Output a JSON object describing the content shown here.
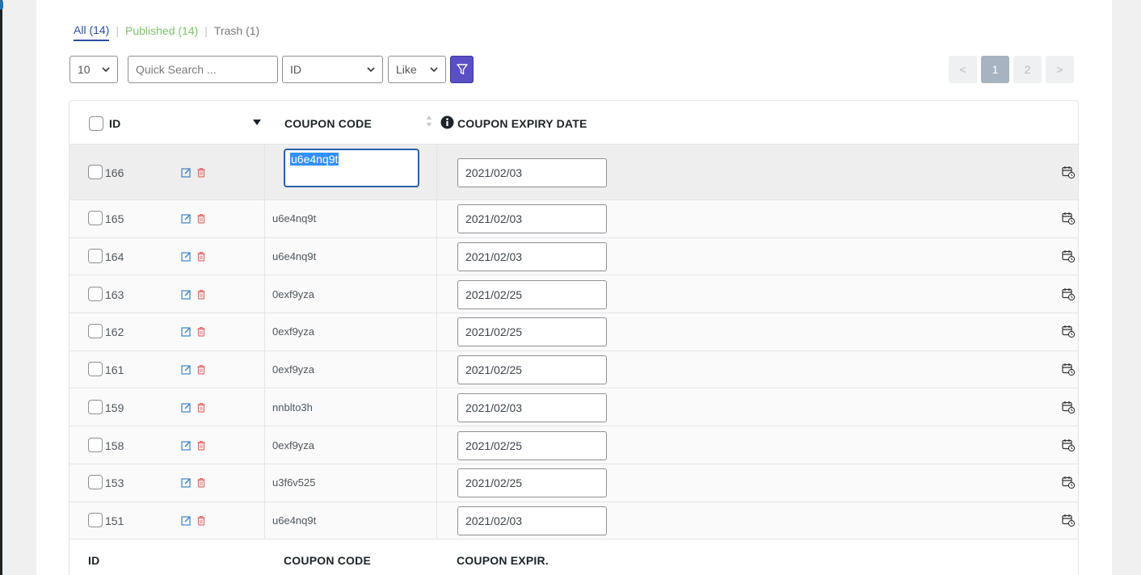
{
  "status_tabs": [
    {
      "label": "All (14)"
    },
    {
      "label": "Published (14)"
    },
    {
      "label": "Trash (1)"
    }
  ],
  "separator": "|",
  "toolbar": {
    "per_page": "10",
    "search_placeholder": "Quick Search ...",
    "field_select": "ID",
    "operator_select": "Like"
  },
  "pagination": {
    "prev": "<",
    "pages": [
      "1",
      "2"
    ],
    "current_page": "1",
    "next": ">"
  },
  "columns": {
    "id": "ID",
    "coupon_code": "COUPON CODE",
    "coupon_expiry_date": "COUPON EXPIRY DATE"
  },
  "footer_columns": {
    "id": "ID",
    "coupon_code": "COUPON CODE",
    "coupon_expiry": "COUPON EXPIR."
  },
  "rows": [
    {
      "id": "166",
      "code": "u6e4nq9t",
      "expiry": "2021/02/03"
    },
    {
      "id": "165",
      "code": "u6e4nq9t",
      "expiry": "2021/02/03"
    },
    {
      "id": "164",
      "code": "u6e4nq9t",
      "expiry": "2021/02/03"
    },
    {
      "id": "163",
      "code": "0exf9yza",
      "expiry": "2021/02/25"
    },
    {
      "id": "162",
      "code": "0exf9yza",
      "expiry": "2021/02/25"
    },
    {
      "id": "161",
      "code": "0exf9yza",
      "expiry": "2021/02/25"
    },
    {
      "id": "159",
      "code": "nnblto3h",
      "expiry": "2021/02/03"
    },
    {
      "id": "158",
      "code": "0exf9yza",
      "expiry": "2021/02/25"
    },
    {
      "id": "153",
      "code": "u3f6v525",
      "expiry": "2021/02/25"
    },
    {
      "id": "151",
      "code": "u6e4nq9t",
      "expiry": "2021/02/03"
    }
  ],
  "colors": {
    "accent_blue": "#2a4fa3",
    "published_green": "#7ec26b",
    "filter_purple": "#5a4fc4",
    "delete_red": "#e06b6b"
  },
  "icons": {
    "edit": "edit-icon",
    "delete": "trash-icon",
    "calendar": "calendar-clock-icon",
    "filter": "filter-icon",
    "info": "info-icon",
    "sort": "sort-icon"
  }
}
